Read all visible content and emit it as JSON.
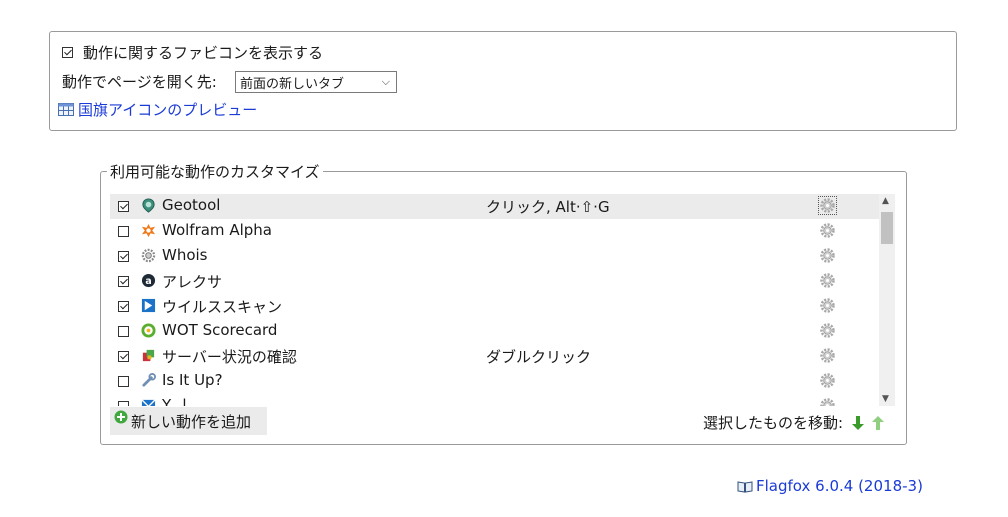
{
  "general": {
    "show_favicon": {
      "label": "動作に関するファビコンを表示する",
      "checked": true
    },
    "open_target": {
      "label": "動作でページを開く先:",
      "value": "前面の新しいタブ"
    },
    "preview_link": "国旗アイコンのプレビュー"
  },
  "actions": {
    "legend": "利用可能な動作のカスタマイズ",
    "items": [
      {
        "name": "Geotool",
        "checked": true,
        "trigger": "クリック, Alt·⇧·G",
        "icon": "geotool-icon",
        "selected": true
      },
      {
        "name": "Wolfram Alpha",
        "checked": false,
        "trigger": "",
        "icon": "wolfram-icon"
      },
      {
        "name": "Whois",
        "checked": true,
        "trigger": "",
        "icon": "whois-icon"
      },
      {
        "name": "アレクサ",
        "checked": true,
        "trigger": "",
        "icon": "alexa-icon"
      },
      {
        "name": "ウイルススキャン",
        "checked": true,
        "trigger": "",
        "icon": "virusscan-icon"
      },
      {
        "name": "WOT Scorecard",
        "checked": false,
        "trigger": "",
        "icon": "wot-icon"
      },
      {
        "name": "サーバー状況の確認",
        "checked": true,
        "trigger": "ダブルクリック",
        "icon": "server-check-icon"
      },
      {
        "name": "Is It Up?",
        "checked": false,
        "trigger": "",
        "icon": "wrench-icon"
      },
      {
        "name": "Y...l...",
        "checked": false,
        "trigger": "",
        "icon": "mail-icon"
      }
    ],
    "add_button": "新しい動作を追加",
    "move_label": "選択したものを移動:"
  },
  "footer": {
    "version": "Flagfox 6.0.4 (2018-3)"
  },
  "colors": {
    "link": "#1a3bd6",
    "green_arrow": "#3a9a2a",
    "selected_row": "#ebebeb"
  }
}
